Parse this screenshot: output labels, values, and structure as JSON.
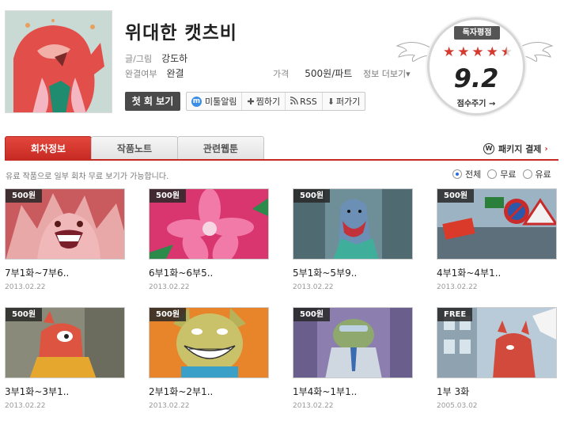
{
  "header": {
    "title": "위대한 캣츠비",
    "author_label": "글/그림",
    "author": "강도하",
    "status_label": "완결여부",
    "status": "완결",
    "price_label": "가격",
    "price": "500원/파트",
    "more_info": "정보 더보기▾"
  },
  "actions": {
    "first_view": "첫 회 보기",
    "notify": "미툴알림",
    "notify_icon": "m",
    "bookmark": "찜하기",
    "rss": "RSS",
    "share": "퍼가기"
  },
  "rating": {
    "label": "독자평점",
    "score": "9.2",
    "stars_filled": 4.5,
    "give": "점수주기 →"
  },
  "tabs": [
    {
      "label": "회차정보",
      "active": true
    },
    {
      "label": "작품노트",
      "active": false
    },
    {
      "label": "관련웹툰",
      "active": false
    }
  ],
  "package": {
    "label": "패키지 결제",
    "icon": "W",
    "arrow": "›"
  },
  "notice": "유료 작품으로 일부 회차 무료 보기가 가능합니다.",
  "filters": [
    {
      "label": "전체",
      "selected": true
    },
    {
      "label": "무료",
      "selected": false
    },
    {
      "label": "유료",
      "selected": false
    }
  ],
  "episodes": [
    {
      "badge": "500원",
      "title": "7부1화~7부6..",
      "date": "2013.02.22",
      "theme": "red-cat"
    },
    {
      "badge": "500원",
      "title": "6부1화~6부5..",
      "date": "2013.02.22",
      "theme": "pink-flower"
    },
    {
      "badge": "500원",
      "title": "5부1화~5부9..",
      "date": "2013.02.22",
      "theme": "shark"
    },
    {
      "badge": "500원",
      "title": "4부1화~4부1..",
      "date": "2013.02.22",
      "theme": "city-signs"
    },
    {
      "badge": "500원",
      "title": "3부1화~3부1..",
      "date": "2013.02.22",
      "theme": "cat-sweater"
    },
    {
      "badge": "500원",
      "title": "2부1화~2부1..",
      "date": "2013.02.22",
      "theme": "grin-dog"
    },
    {
      "badge": "500원",
      "title": "1부4화~1부1..",
      "date": "2013.02.22",
      "theme": "frog-suit"
    },
    {
      "badge": "FREE",
      "title": "1부 3화",
      "date": "2005.03.02",
      "theme": "cat-window"
    }
  ],
  "colors": {
    "accent": "#c52a22",
    "star": "#d63a2f",
    "dark_button": "#4a4a4a",
    "link_blue": "#3a8ee6"
  }
}
